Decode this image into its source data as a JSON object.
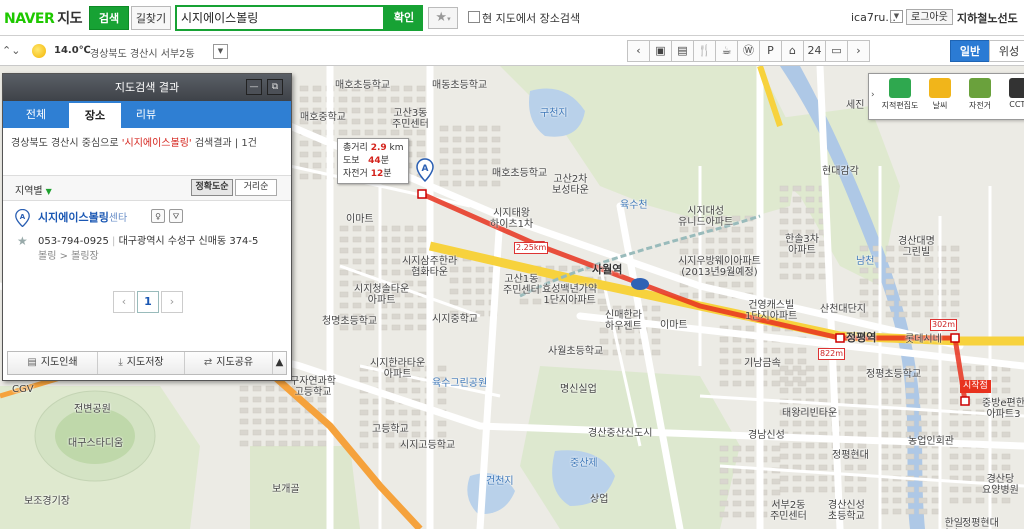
{
  "header": {
    "logo_brand": "NAVER",
    "logo_service": "지도",
    "tab_search": "검색",
    "tab_route": "길찾기",
    "search_value": "시지에이스볼링",
    "search_button": "확인",
    "star_icon": "star-icon",
    "checkbox_label": "현 지도에서 장소검색",
    "user_id": "ica7ru...",
    "logout": "로그아웃",
    "subway_map": "지하철노선도"
  },
  "subbar": {
    "collapse_icon": "chevrons-icon",
    "temperature": "14.0℃",
    "location": "경상북도 경산시 서부2동",
    "category_icons": [
      "chevron-left-icon",
      "bus-icon",
      "subway-icon",
      "restaurant-icon",
      "cafe-icon",
      "bank-icon",
      "parking-icon",
      "shopping-icon",
      "convenience-store-icon",
      "hotel-icon",
      "chevron-right-icon"
    ],
    "category_glyphs": [
      "‹",
      "▣",
      "▤",
      "🍴",
      "☕",
      "Ⓦ",
      "P",
      "⌂",
      "24",
      "▭",
      "›"
    ],
    "mode_normal": "일반",
    "mode_satellite": "위성"
  },
  "tools": {
    "items": [
      {
        "label": "지적편집도",
        "icon": "cadastral-map-icon",
        "color": "#2fa84f"
      },
      {
        "label": "날씨",
        "icon": "weather-icon",
        "color": "#f1b51a"
      },
      {
        "label": "자전거",
        "icon": "bicycle-icon",
        "color": "#6aa13c"
      },
      {
        "label": "CCTV",
        "icon": "cctv-icon",
        "color": "#333333"
      }
    ]
  },
  "route": {
    "total_label": "총거리",
    "total_value": "2.9",
    "total_unit": "km",
    "walk_label": "도보",
    "walk_value": "44",
    "walk_unit": "분",
    "bike_label": "자전거",
    "bike_value": "12",
    "bike_unit": "분",
    "seg_1": "2.25km",
    "seg_2": "822m",
    "seg_3": "302m",
    "start_label": "시작점",
    "route_color": "#e8321e"
  },
  "map": {
    "labels": {
      "maeho_middle": "매호중학교",
      "maeho_elem": "매호초등학교",
      "gosan3": "고산3동\n주민센터",
      "maedong_elem": "매동초등학교",
      "guncheonji": "구천지",
      "gosan2": "고산2차\n보성타운",
      "maeho_elem2": "매호초등학교",
      "sijitaeyoung": "시지태왕\n하이츠1차",
      "emart1": "이마트",
      "sijidaesung": "시지대성\n유니드아파트",
      "hyundai_galgak": "현대감각",
      "gyeongsan_daejang": "경산대명\n그린빌",
      "hanul3": "한솔3차\n아파트",
      "sijiwoobang": "시지우방웨이아파트\n(2013년9월예정)",
      "geunyoung": "건영캐스빌\n1단지아파트",
      "sanchon": "산천대단지",
      "sijisamju": "시지삼주한라\n협화타운",
      "gosan1": "고산1동\n주민센터",
      "hyoseong": "효성백년가약\n1단지아파트",
      "sijiyeok": "사월역",
      "sinmae": "신매한라\n하우젠트",
      "emart2": "이마트",
      "sijicheong": "시지청솔타운\n아파트",
      "sijimiddle": "시지중학교",
      "cheongmyeong": "청명초등학교",
      "sawol_elem": "사월초등학교",
      "myeongsi": "명신실업",
      "gina": "기남금속",
      "jeongpyeong": "정평역",
      "jeongpyeong_elem": "정평초등학교",
      "taewang": "태왕리빈타운",
      "gyeongsan_sinsi": "경산중산신도시",
      "jungsanje": "중산제",
      "gangseo": "경남신성",
      "jeongpyeong_hyundai": "정평현대",
      "nonghyup": "농업인회관",
      "sijigo": "시지고등학교",
      "sinhatown": "시지한라타운\n아파트",
      "science_high": "구자연과학\n고등학교",
      "yugok": "육수그린공원",
      "cgv": "CGV",
      "stadium_park": "전변공원",
      "daegu_stadium": "대구스타디움",
      "bojo": "보조경기장",
      "bogaegol": "보개골",
      "geoncheonji": "건천지",
      "sangeop": "상업",
      "seobu2": "서부2동\n주민센터",
      "gyeongsan_sinseong": "경산신성\n초등학교",
      "gyeongsan_dang": "경산당\n요양병원",
      "jungbang": "중방e편한\n아파트3",
      "lotte": "롯데시네",
      "nam_river": "남천",
      "sejin": "세진",
      "yuksu": "육수천",
      "jamsil": "정평현대",
      "jeonggo": "고등학교",
      "hanil": "한일\n아파트"
    }
  },
  "panel": {
    "title": "지도검색 결과",
    "minimize_icon": "minimize-icon",
    "popout_icon": "popout-icon",
    "tabs": [
      "전체",
      "장소",
      "리뷰"
    ],
    "summary_prefix": "경상북도 경산시 중심으로 ",
    "summary_keyword": "'시지에이스볼링'",
    "summary_suffix": " 검색결과 | 1건",
    "region_filter": "지역별",
    "sort_accuracy": "정확도순",
    "sort_distance": "거리순",
    "result": {
      "marker": "A",
      "name": "시지에이스볼링",
      "name_suffix": "센타",
      "badge_1": "♀",
      "badge_2": "⛛",
      "phone": "053-794-0925",
      "address": "대구광역시 수성구 신매동 374-5",
      "category": "볼링 > 볼링장"
    },
    "page": "1",
    "footer": {
      "print": "지도인쇄",
      "save": "지도저장",
      "share": "지도공유"
    }
  }
}
